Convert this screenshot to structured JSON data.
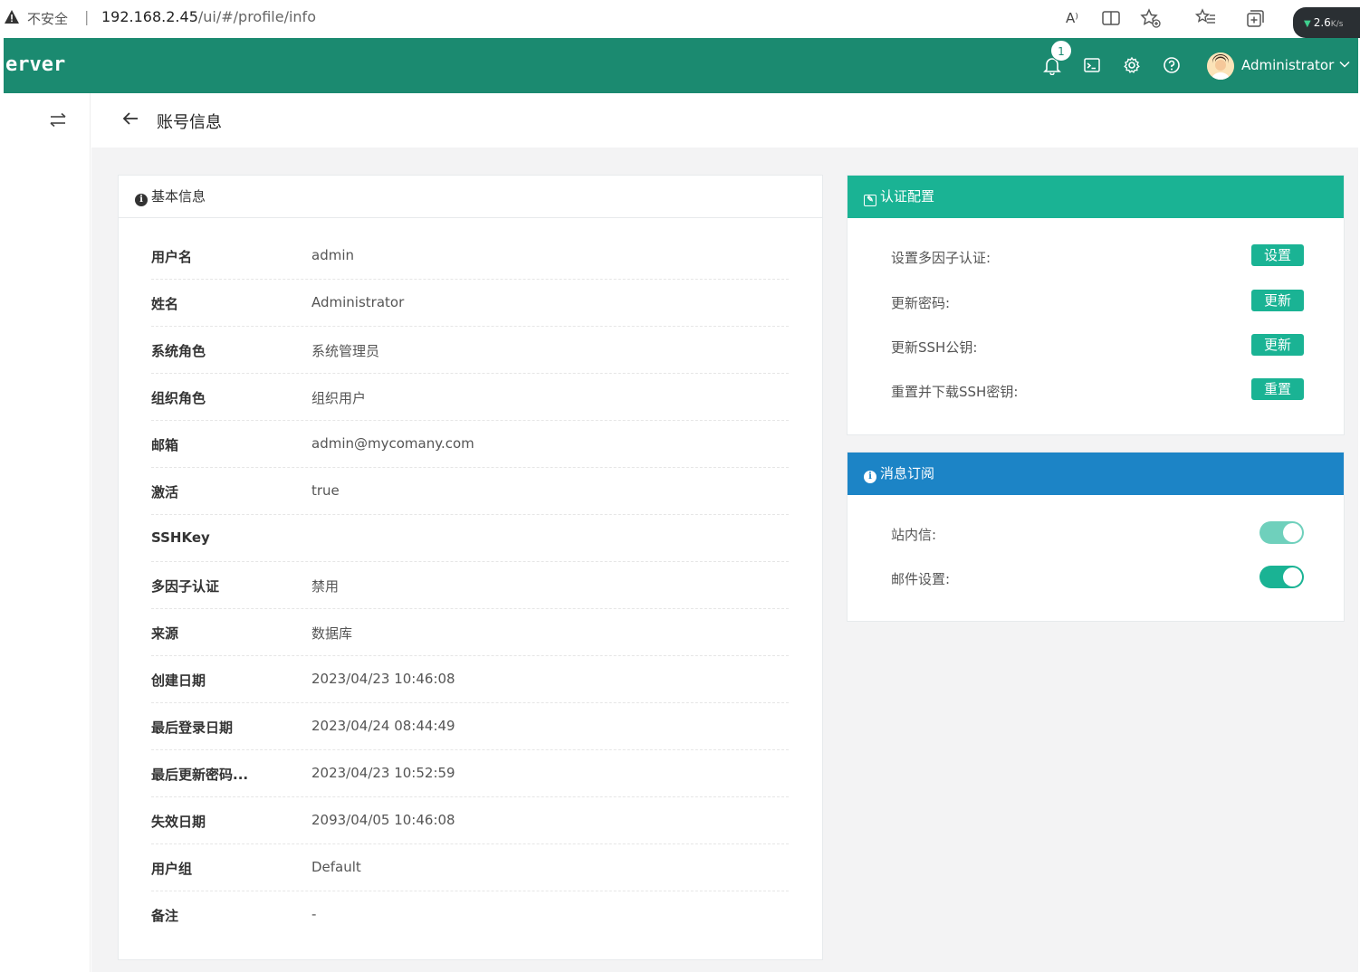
{
  "browser": {
    "insecure_label": "不安全",
    "separator": "|",
    "url_host": "192.168.2.45",
    "url_path": "/ui/#/profile/info",
    "read_aloud": "A⁾",
    "speed_value": "2.6",
    "speed_unit": "K/s"
  },
  "header": {
    "brand": "erver",
    "notification_count": "1",
    "user_name": "Administrator"
  },
  "page": {
    "title": "账号信息"
  },
  "basic_info": {
    "title": "基本信息",
    "rows": [
      {
        "label": "用户名",
        "value": "admin"
      },
      {
        "label": "姓名",
        "value": "Administrator"
      },
      {
        "label": "系统角色",
        "value": "系统管理员"
      },
      {
        "label": "组织角色",
        "value": "组织用户"
      },
      {
        "label": "邮箱",
        "value": "admin@mycomany.com"
      },
      {
        "label": "激活",
        "value": "true"
      },
      {
        "label": "SSHKey",
        "value": ""
      },
      {
        "label": "多因子认证",
        "value": "禁用"
      },
      {
        "label": "来源",
        "value": "数据库"
      },
      {
        "label": "创建日期",
        "value": "2023/04/23 10:46:08"
      },
      {
        "label": "最后登录日期",
        "value": "2023/04/24 08:44:49"
      },
      {
        "label": "最后更新密码...",
        "value": "2023/04/23 10:52:59"
      },
      {
        "label": "失效日期",
        "value": "2093/04/05 10:46:08"
      },
      {
        "label": "用户组",
        "value": "Default"
      },
      {
        "label": "备注",
        "value": "-"
      }
    ]
  },
  "auth_config": {
    "title": "认证配置",
    "rows": [
      {
        "label": "设置多因子认证:",
        "button": "设置"
      },
      {
        "label": "更新密码:",
        "button": "更新"
      },
      {
        "label": "更新SSH公钥:",
        "button": "更新"
      },
      {
        "label": "重置并下载SSH密钥:",
        "button": "重置"
      }
    ]
  },
  "subscription": {
    "title": "消息订阅",
    "rows": [
      {
        "label": "站内信:"
      },
      {
        "label": "邮件设置:"
      }
    ]
  },
  "colors": {
    "header_green": "#1b8a70",
    "primary": "#1ab394",
    "info_blue": "#1c84c6"
  }
}
